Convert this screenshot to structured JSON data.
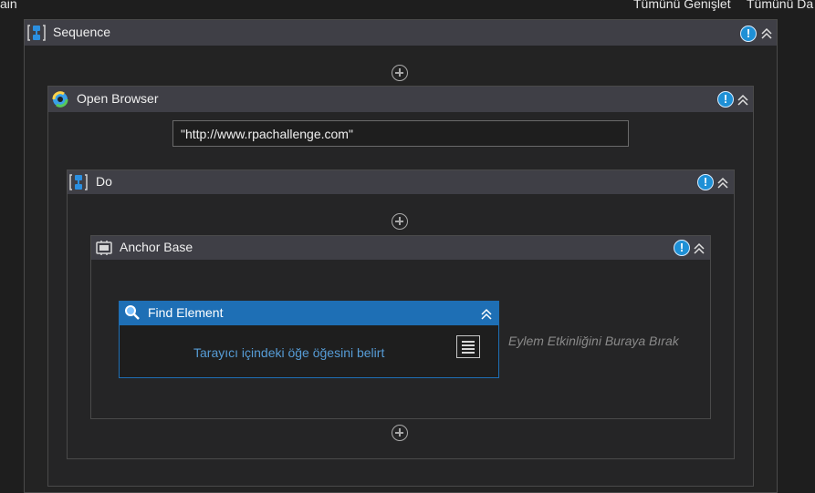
{
  "topbar": {
    "left_text": "ain",
    "expand_all": "Tümünü Genişlet",
    "collapse_all": "Tümünü Da"
  },
  "sequence": {
    "title": "Sequence"
  },
  "open_browser": {
    "title": "Open Browser",
    "url_value": "\"http://www.rpachallenge.com\""
  },
  "do": {
    "title": "Do"
  },
  "anchor_base": {
    "title": "Anchor Base",
    "drop_hint": "Eylem Etkinliğini Buraya Bırak"
  },
  "find_element": {
    "title": "Find Element",
    "action_link": "Tarayıcı içindeki öğe öğesini belirt"
  },
  "icons": {
    "sequence": "sequence-icon",
    "warning": "warning-icon",
    "collapse": "chevron-double-up-icon",
    "add": "plus-circle-icon",
    "open_browser": "browser-icon",
    "anchor": "anchor-icon",
    "search": "search-icon",
    "menu": "menu-icon"
  },
  "colors": {
    "accent": "#1e6fb5",
    "warning": "#1e90d6",
    "link": "#569cd6",
    "header": "#3f3f46"
  }
}
